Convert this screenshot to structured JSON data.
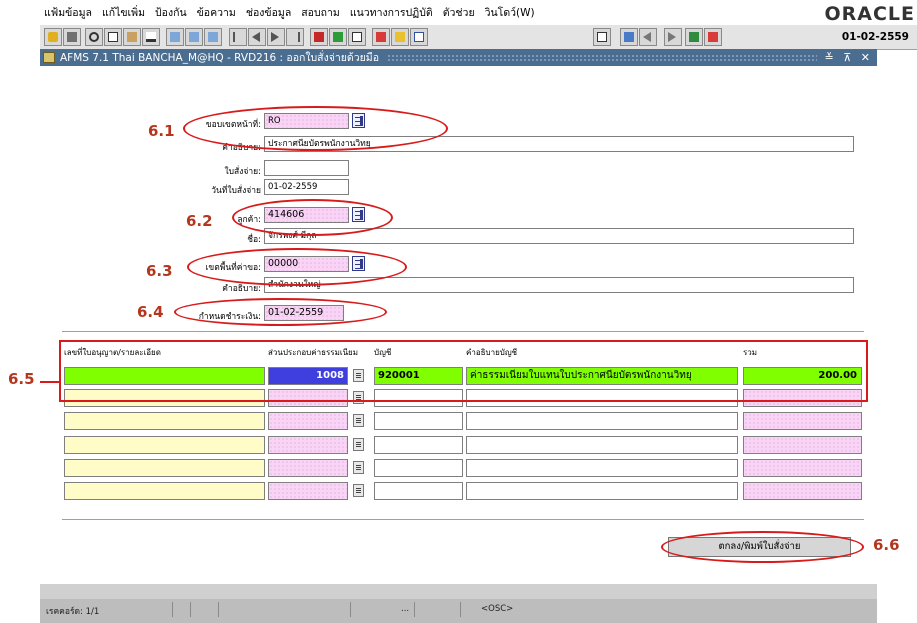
{
  "menu": [
    "แฟ้มข้อมูล",
    "แก้ไขเพิ่ม",
    "ป้องกัน",
    "ข้อความ",
    "ช่องข้อมูล",
    "สอบถาม",
    "แนวทางการปฏิบัติ",
    "ตัวช่วย",
    "วินโดว์(W)"
  ],
  "brand": "ORACLE",
  "toolbar": {
    "date": "01-02-2559"
  },
  "window": {
    "title": "AFMS 7.1 Thai BANCHA_M@HQ - RVD216 : ออกใบสั่งจ่ายด้วยมือ",
    "controls": "≚ ⊼ ✕"
  },
  "form": {
    "officer_label": "ขอบเขตหน้าที่:",
    "officer_value": "RO",
    "officer_desc_label": "คำอธิบาย:",
    "officer_desc_value": "ประกาศนียบัตรพนักงานวิทยุ",
    "voucher_label": "ใบสั่งจ่าย:",
    "voucher_value": "",
    "voucher_date_label": "วันที่ใบสั่งจ่าย",
    "voucher_date_value": "01-02-2559",
    "customer_label": "ลูกค้า:",
    "customer_value": "414606",
    "name_label": "ชื่อ:",
    "name_value": "จักรพงศ์ มีกุล",
    "area_label": "เขตพื้นที่ค่าขอ:",
    "area_value": "00000",
    "area_desc_label": "คำอธิบาย:",
    "area_desc_value": "สำนักงานใหญ่",
    "due_label": "กำหนดชำระเงิน:",
    "due_value": "01-02-2559"
  },
  "table": {
    "headers": {
      "license": "เลขที่ใบอนุญาต/รายละเอียด",
      "fee": "ส่วนประกอบค่าธรรมเนียม",
      "account": "บัญชี",
      "desc": "คำอธิบายบัญชี",
      "total": "รวม"
    },
    "rows": [
      {
        "license": "",
        "fee": "1008",
        "account": "920001",
        "desc": "ค่าธรรมเนียมใบแทนใบประกาศนียบัตรพนักงานวิทยุ",
        "total": "200.00"
      },
      {
        "license": "",
        "fee": "",
        "account": "",
        "desc": "",
        "total": ""
      },
      {
        "license": "",
        "fee": "",
        "account": "",
        "desc": "",
        "total": ""
      },
      {
        "license": "",
        "fee": "",
        "account": "",
        "desc": "",
        "total": ""
      },
      {
        "license": "",
        "fee": "",
        "account": "",
        "desc": "",
        "total": ""
      },
      {
        "license": "",
        "fee": "",
        "account": "",
        "desc": "",
        "total": ""
      }
    ]
  },
  "button": {
    "print_label": "ตกลง/พิมพ์ใบสั่งจ่าย"
  },
  "callouts": [
    "6.1",
    "6.2",
    "6.3",
    "6.4",
    "6.5",
    "6.6"
  ],
  "status": {
    "record": "เรคคอร์ด: 1/1",
    "ellipsis": "...",
    "mode": "<OSC>"
  },
  "colors": {
    "required_field": "#f9d4f6",
    "current_row": "#7fff00",
    "detail_field": "#fffcc8",
    "annotation": "#d91a1a",
    "titlebar": "#4b6d90"
  }
}
